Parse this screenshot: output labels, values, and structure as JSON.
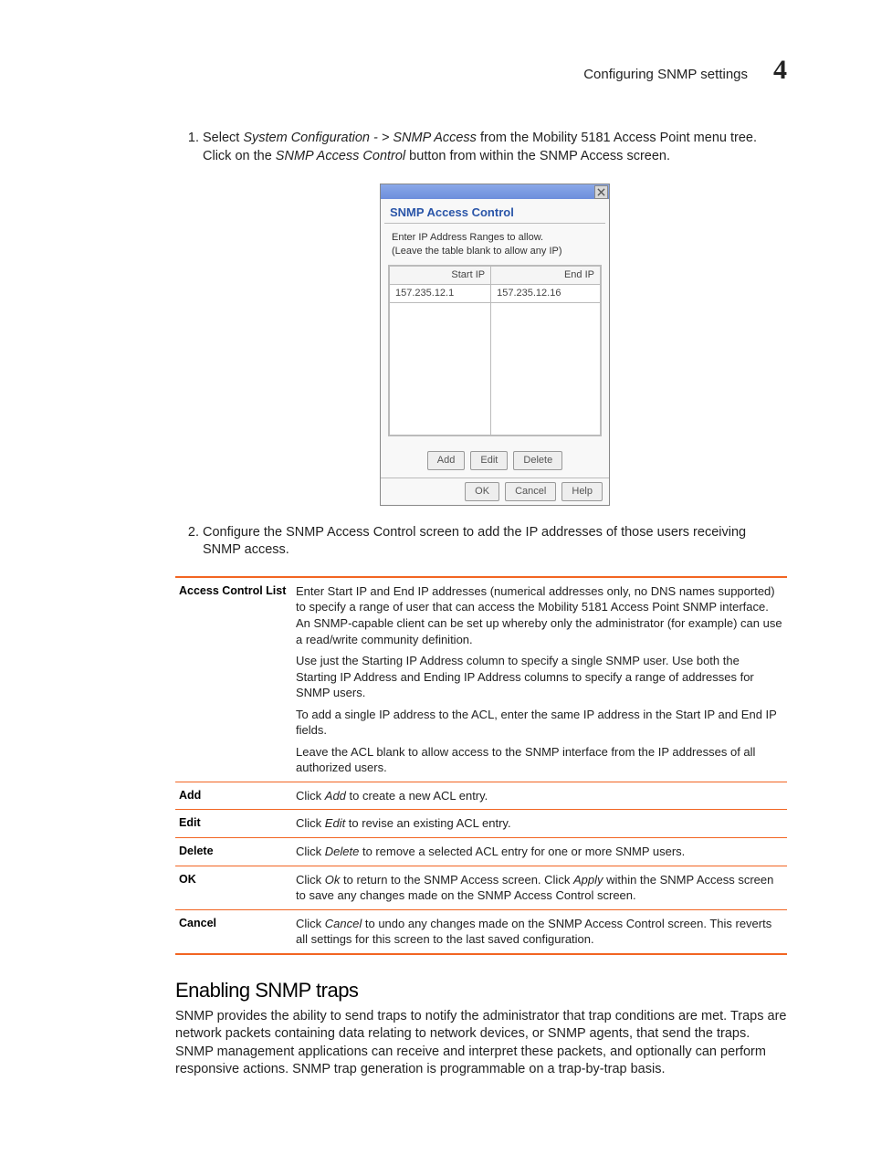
{
  "header": {
    "running_title": "Configuring SNMP settings",
    "chapter_number": "4"
  },
  "steps": {
    "s1": {
      "pre": "Select ",
      "nav": "System Configuration - > SNMP Access",
      "mid": " from the Mobility 5181 Access Point menu tree. Click on the ",
      "btn": "SNMP Access Control",
      "post": " button from within the SNMP Access screen."
    },
    "s2": "Configure the SNMP Access Control screen to add the IP addresses of those users receiving SNMP access."
  },
  "dialog": {
    "title": "SNMP Access Control",
    "instr_line1": "Enter IP Address Ranges to allow.",
    "instr_line2": "(Leave the table blank to allow any IP)",
    "col_start": "Start IP",
    "col_end": "End IP",
    "rows": [
      {
        "start": "157.235.12.1",
        "end": "157.235.12.16"
      }
    ],
    "btn_add": "Add",
    "btn_edit": "Edit",
    "btn_delete": "Delete",
    "btn_ok": "OK",
    "btn_cancel": "Cancel",
    "btn_help": "Help"
  },
  "defs": {
    "acl": {
      "term": "Access Control List",
      "p1": "Enter Start IP and End IP addresses (numerical addresses only, no DNS names supported) to specify a range of user that can access the Mobility 5181 Access Point SNMP interface. An SNMP-capable client can be set up whereby only the administrator (for example) can use a read/write community definition.",
      "p2": "Use just the Starting IP Address column to specify a single SNMP user. Use both the Starting IP Address and Ending IP Address columns to specify a range of addresses for SNMP users.",
      "p3": "To add a single IP address to the ACL, enter the same IP address in the Start IP and End IP fields.",
      "p4": "Leave the ACL blank to allow access to the SNMP interface from the IP addresses of all authorized users."
    },
    "add": {
      "term": "Add",
      "pre": "Click ",
      "em": "Add",
      "post": " to create a new ACL entry."
    },
    "edit": {
      "term": "Edit",
      "pre": "Click ",
      "em": "Edit",
      "post": " to revise an existing ACL entry."
    },
    "delete": {
      "term": "Delete",
      "pre": "Click ",
      "em": "Delete",
      "post": " to remove a selected ACL entry for one or more SNMP users."
    },
    "ok": {
      "term": "OK",
      "pre": "Click ",
      "em1": "Ok",
      "mid": " to return to the SNMP Access screen. Click ",
      "em2": "Apply",
      "post": " within the SNMP Access screen to save any changes made on the SNMP Access Control screen."
    },
    "cancel": {
      "term": "Cancel",
      "pre": "Click ",
      "em": "Cancel",
      "post": " to undo any changes made on the SNMP Access Control screen. This reverts all settings for this screen to the last saved configuration."
    }
  },
  "section": {
    "heading": "Enabling SNMP traps",
    "body": "SNMP provides the ability to send traps to notify the administrator that trap conditions are met. Traps are network packets containing data relating to network devices, or SNMP agents, that send the traps. SNMP management applications can receive and interpret these packets, and optionally can perform responsive actions. SNMP trap generation is programmable on a trap-by-trap basis."
  }
}
